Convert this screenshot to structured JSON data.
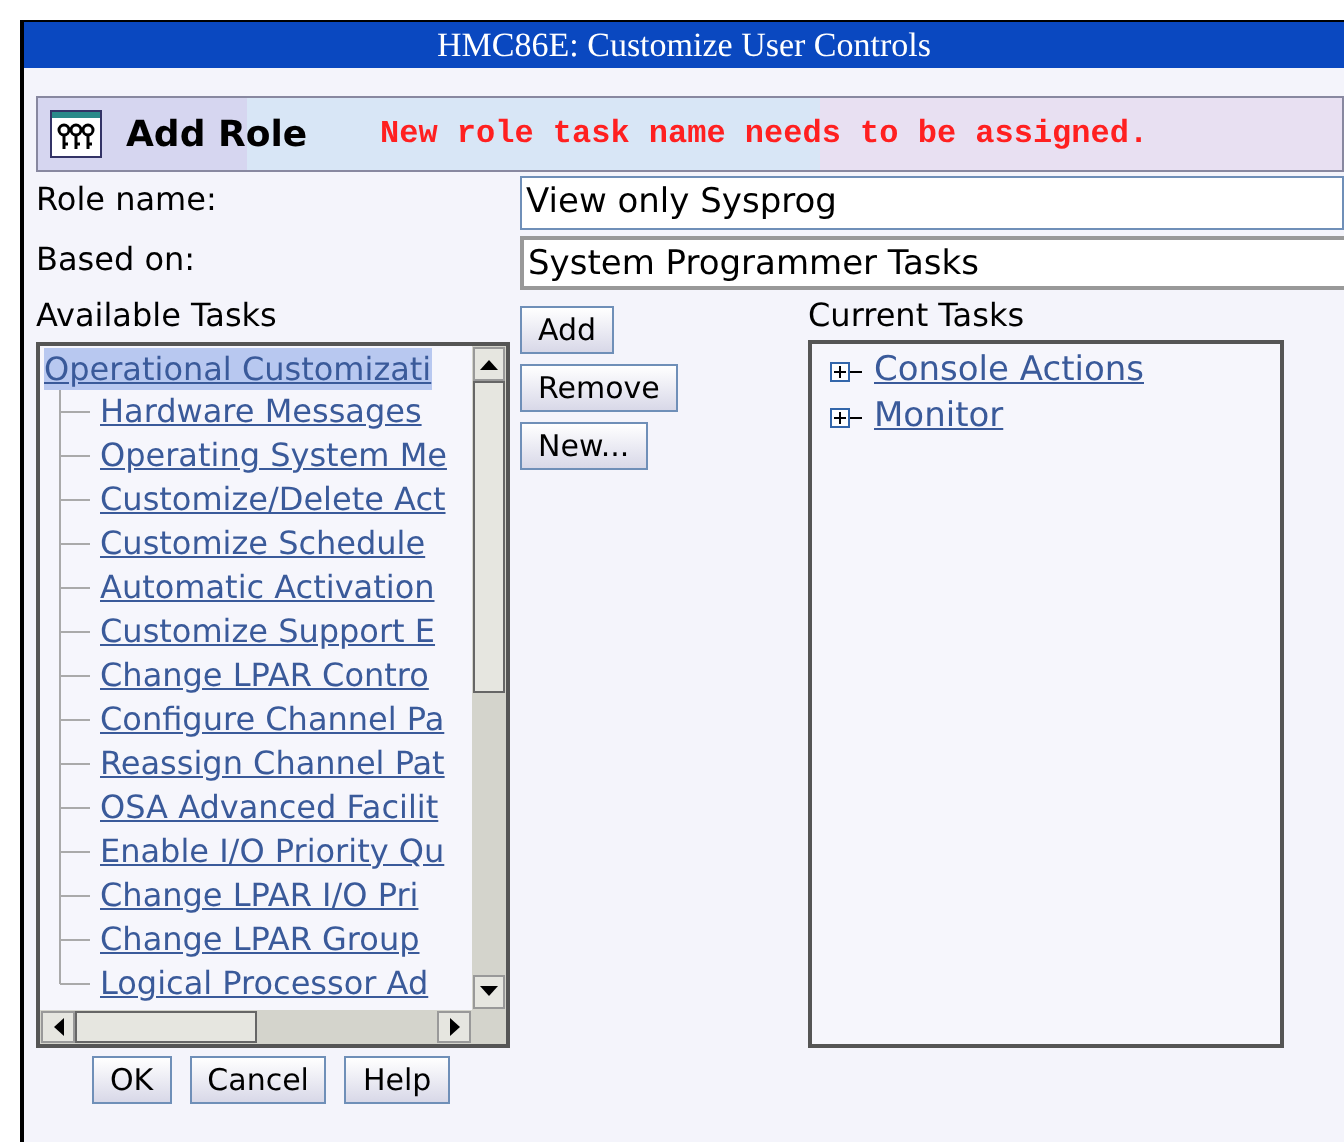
{
  "window": {
    "title": "HMC86E: Customize User Controls"
  },
  "header": {
    "title": "Add Role",
    "message": "New role task name needs to be assigned."
  },
  "fields": [
    {
      "label": "Role name:",
      "value": "View only Sysprog",
      "focused": true
    },
    {
      "label": "Based on:",
      "value": "System Programmer Tasks",
      "focused": false
    }
  ],
  "available_tasks": {
    "label": "Available Tasks",
    "root": {
      "label": "Operational Customizati",
      "selected": true,
      "children": [
        {
          "label": "Hardware Messages",
          "selected": false
        },
        {
          "label": "Operating System Me",
          "selected": false
        },
        {
          "label": "Customize/Delete Act",
          "selected": false
        },
        {
          "label": "Customize Schedule",
          "selected": false
        },
        {
          "label": "Automatic Activation",
          "selected": false
        },
        {
          "label": "Customize Support E",
          "selected": false
        },
        {
          "label": "Change LPAR Contro",
          "selected": false
        },
        {
          "label": "Configure Channel Pa",
          "selected": false
        },
        {
          "label": "Reassign Channel Pat",
          "selected": false
        },
        {
          "label": "OSA Advanced Facilit",
          "selected": false
        },
        {
          "label": "Enable I/O Priority Qu",
          "selected": false
        },
        {
          "label": "Change LPAR I/O Pri",
          "selected": false
        },
        {
          "label": "Change LPAR Group",
          "selected": false
        },
        {
          "label": "Logical Processor Ad",
          "selected": false
        }
      ]
    }
  },
  "action_buttons": [
    "Add",
    "Remove",
    "New..."
  ],
  "current_tasks": {
    "label": "Current Tasks",
    "items": [
      {
        "label": "Console Actions",
        "expanded": false
      },
      {
        "label": "Monitor",
        "expanded": false
      }
    ]
  },
  "dialog_buttons": [
    "OK",
    "Cancel",
    "Help"
  ]
}
